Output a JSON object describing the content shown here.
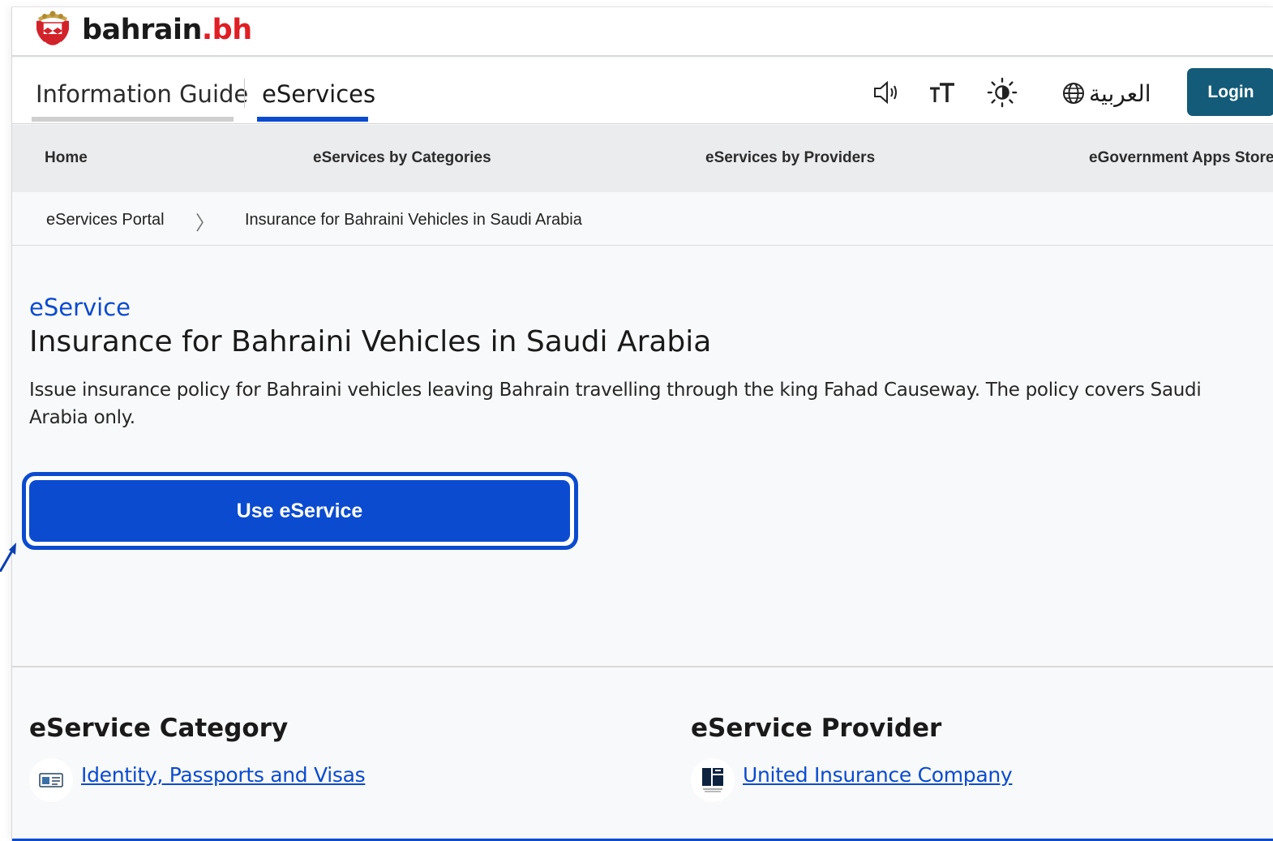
{
  "brand": {
    "name_main": "bahrain",
    "name_dot": ".bh"
  },
  "tabs": [
    {
      "label": "Information Guide"
    },
    {
      "label": "eServices"
    }
  ],
  "tools": {
    "language_label": "العربية",
    "login_label": "Login"
  },
  "main_nav": [
    {
      "label": "Home"
    },
    {
      "label": "eServices by Categories"
    },
    {
      "label": "eServices by Providers"
    },
    {
      "label": "eGovernment Apps Store"
    }
  ],
  "breadcrumb": [
    {
      "label": "eServices Portal"
    },
    {
      "label": "Insurance for Bahraini Vehicles in Saudi Arabia"
    }
  ],
  "service": {
    "kicker": "eService",
    "title": "Insurance for Bahraini Vehicles in Saudi Arabia",
    "description": "Issue insurance policy for Bahraini vehicles leaving Bahrain travelling through the king Fahad Causeway. The policy covers Saudi Arabia only.",
    "button_label": "Use eService"
  },
  "category": {
    "heading": "eService Category",
    "link": "Identity, Passports and Visas"
  },
  "provider": {
    "heading": "eService Provider",
    "link": "United Insurance Company"
  },
  "colors": {
    "accent": "#0b4bd0",
    "login": "#135b78",
    "brand_red": "#e01e24"
  }
}
